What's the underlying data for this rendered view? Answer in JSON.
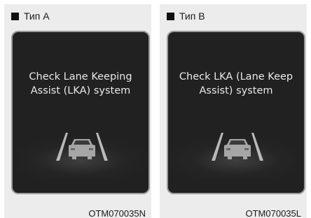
{
  "panels": [
    {
      "header": "Тип A",
      "message_line1": "Check Lane Keeping",
      "message_line2": "Assist (LKA) system",
      "caption": "OTM070035N"
    },
    {
      "header": "Тип B",
      "message_line1": "Check LKA (Lane Keep",
      "message_line2": "Assist) system",
      "caption": "OTM070035L"
    }
  ],
  "icons": {
    "header_marker": "square-icon",
    "warning_graphic": "lane-car-icon"
  },
  "colors": {
    "panel_bg": "#ececec",
    "display_bg": "#212121",
    "display_border": "#9a9a9a",
    "message_text": "#e9e9e9"
  }
}
